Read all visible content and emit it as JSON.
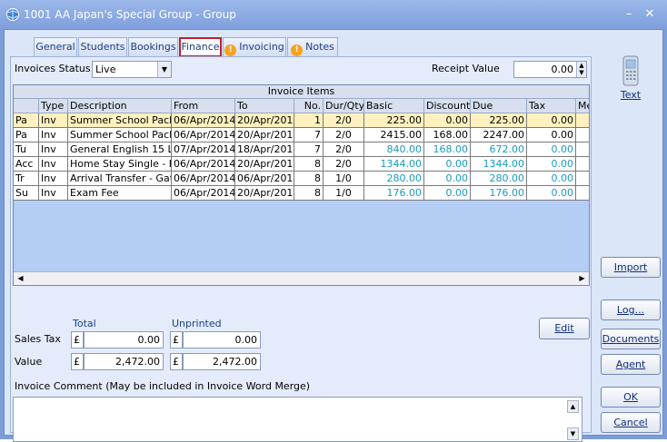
{
  "window": {
    "title": "1001 AA Japan's Special Group - Group",
    "min_label": "–",
    "close_label": "✕"
  },
  "tabs": [
    {
      "label": "General",
      "active": false
    },
    {
      "label": "Students",
      "active": false
    },
    {
      "label": "Bookings",
      "active": false
    },
    {
      "label": "Finance",
      "active": true
    },
    {
      "label": "Invoicing",
      "active": false,
      "icon": "info-icon"
    },
    {
      "label": "Notes",
      "active": false,
      "icon": "info-icon"
    }
  ],
  "finance": {
    "invoices_status_label": "Invoices Status",
    "invoices_status_value": "Live",
    "receipt_value_label": "Receipt Value",
    "receipt_value": "0.00",
    "grid_title": "Invoice Items",
    "columns": [
      "",
      "Type",
      "Description",
      "From",
      "To",
      "No.",
      "Dur/Qty",
      "Basic",
      "Discount",
      "Due",
      "Tax",
      "Me"
    ],
    "rows": [
      {
        "c0": "Pa",
        "type": "Inv",
        "desc": "Summer School Pack",
        "from": "06/Apr/2014",
        "to": "20/Apr/201",
        "no": "1",
        "dur": "2/0",
        "basic": "225.00",
        "discount": "0.00",
        "due": "225.00",
        "tax": "0.00",
        "style": "sel"
      },
      {
        "c0": "Pa",
        "type": "Inv",
        "desc": "Summer School Pack",
        "from": "06/Apr/2014",
        "to": "20/Apr/201",
        "no": "7",
        "dur": "2/0",
        "basic": "2415.00",
        "discount": "168.00",
        "due": "2247.00",
        "tax": "0.00",
        "style": "plain"
      },
      {
        "c0": "Tu",
        "type": "Inv",
        "desc": "General English 15 L",
        "from": "07/Apr/2014",
        "to": "18/Apr/201",
        "no": "7",
        "dur": "2/0",
        "basic": "840.00",
        "discount": "168.00",
        "due": "672.00",
        "tax": "0.00",
        "style": "teal"
      },
      {
        "c0": "Acc",
        "type": "Inv",
        "desc": "Home Stay Single - B",
        "from": "06/Apr/2014",
        "to": "20/Apr/201",
        "no": "8",
        "dur": "2/0",
        "basic": "1344.00",
        "discount": "0.00",
        "due": "1344.00",
        "tax": "0.00",
        "style": "teal"
      },
      {
        "c0": "Tr",
        "type": "Inv",
        "desc": "Arrival Transfer - Gat",
        "from": "06/Apr/2014",
        "to": "06/Apr/201",
        "no": "8",
        "dur": "1/0",
        "basic": "280.00",
        "discount": "0.00",
        "due": "280.00",
        "tax": "0.00",
        "style": "teal"
      },
      {
        "c0": "Su",
        "type": "Inv",
        "desc": "Exam Fee",
        "from": "06/Apr/2014",
        "to": "20/Apr/201",
        "no": "8",
        "dur": "1/0",
        "basic": "176.00",
        "discount": "0.00",
        "due": "176.00",
        "tax": "0.00",
        "style": "teal"
      }
    ],
    "total_label": "Total",
    "unprinted_label": "Unprinted",
    "sales_tax_label": "Sales Tax",
    "value_label": "Value",
    "currency": "£",
    "sales_tax_total": "0.00",
    "sales_tax_unprinted": "0.00",
    "value_total": "2,472.00",
    "value_unprinted": "2,472.00",
    "edit_label": "Edit",
    "comment_label": "Invoice Comment (May be included in Invoice Word Merge)",
    "comment_value": ""
  },
  "sidebar": {
    "text_label": "Text",
    "import_label": "Import",
    "log_label": "Log...",
    "documents_label": "Documents",
    "agent_label": "Agent",
    "ok_label": "OK",
    "cancel_label": "Cancel"
  }
}
